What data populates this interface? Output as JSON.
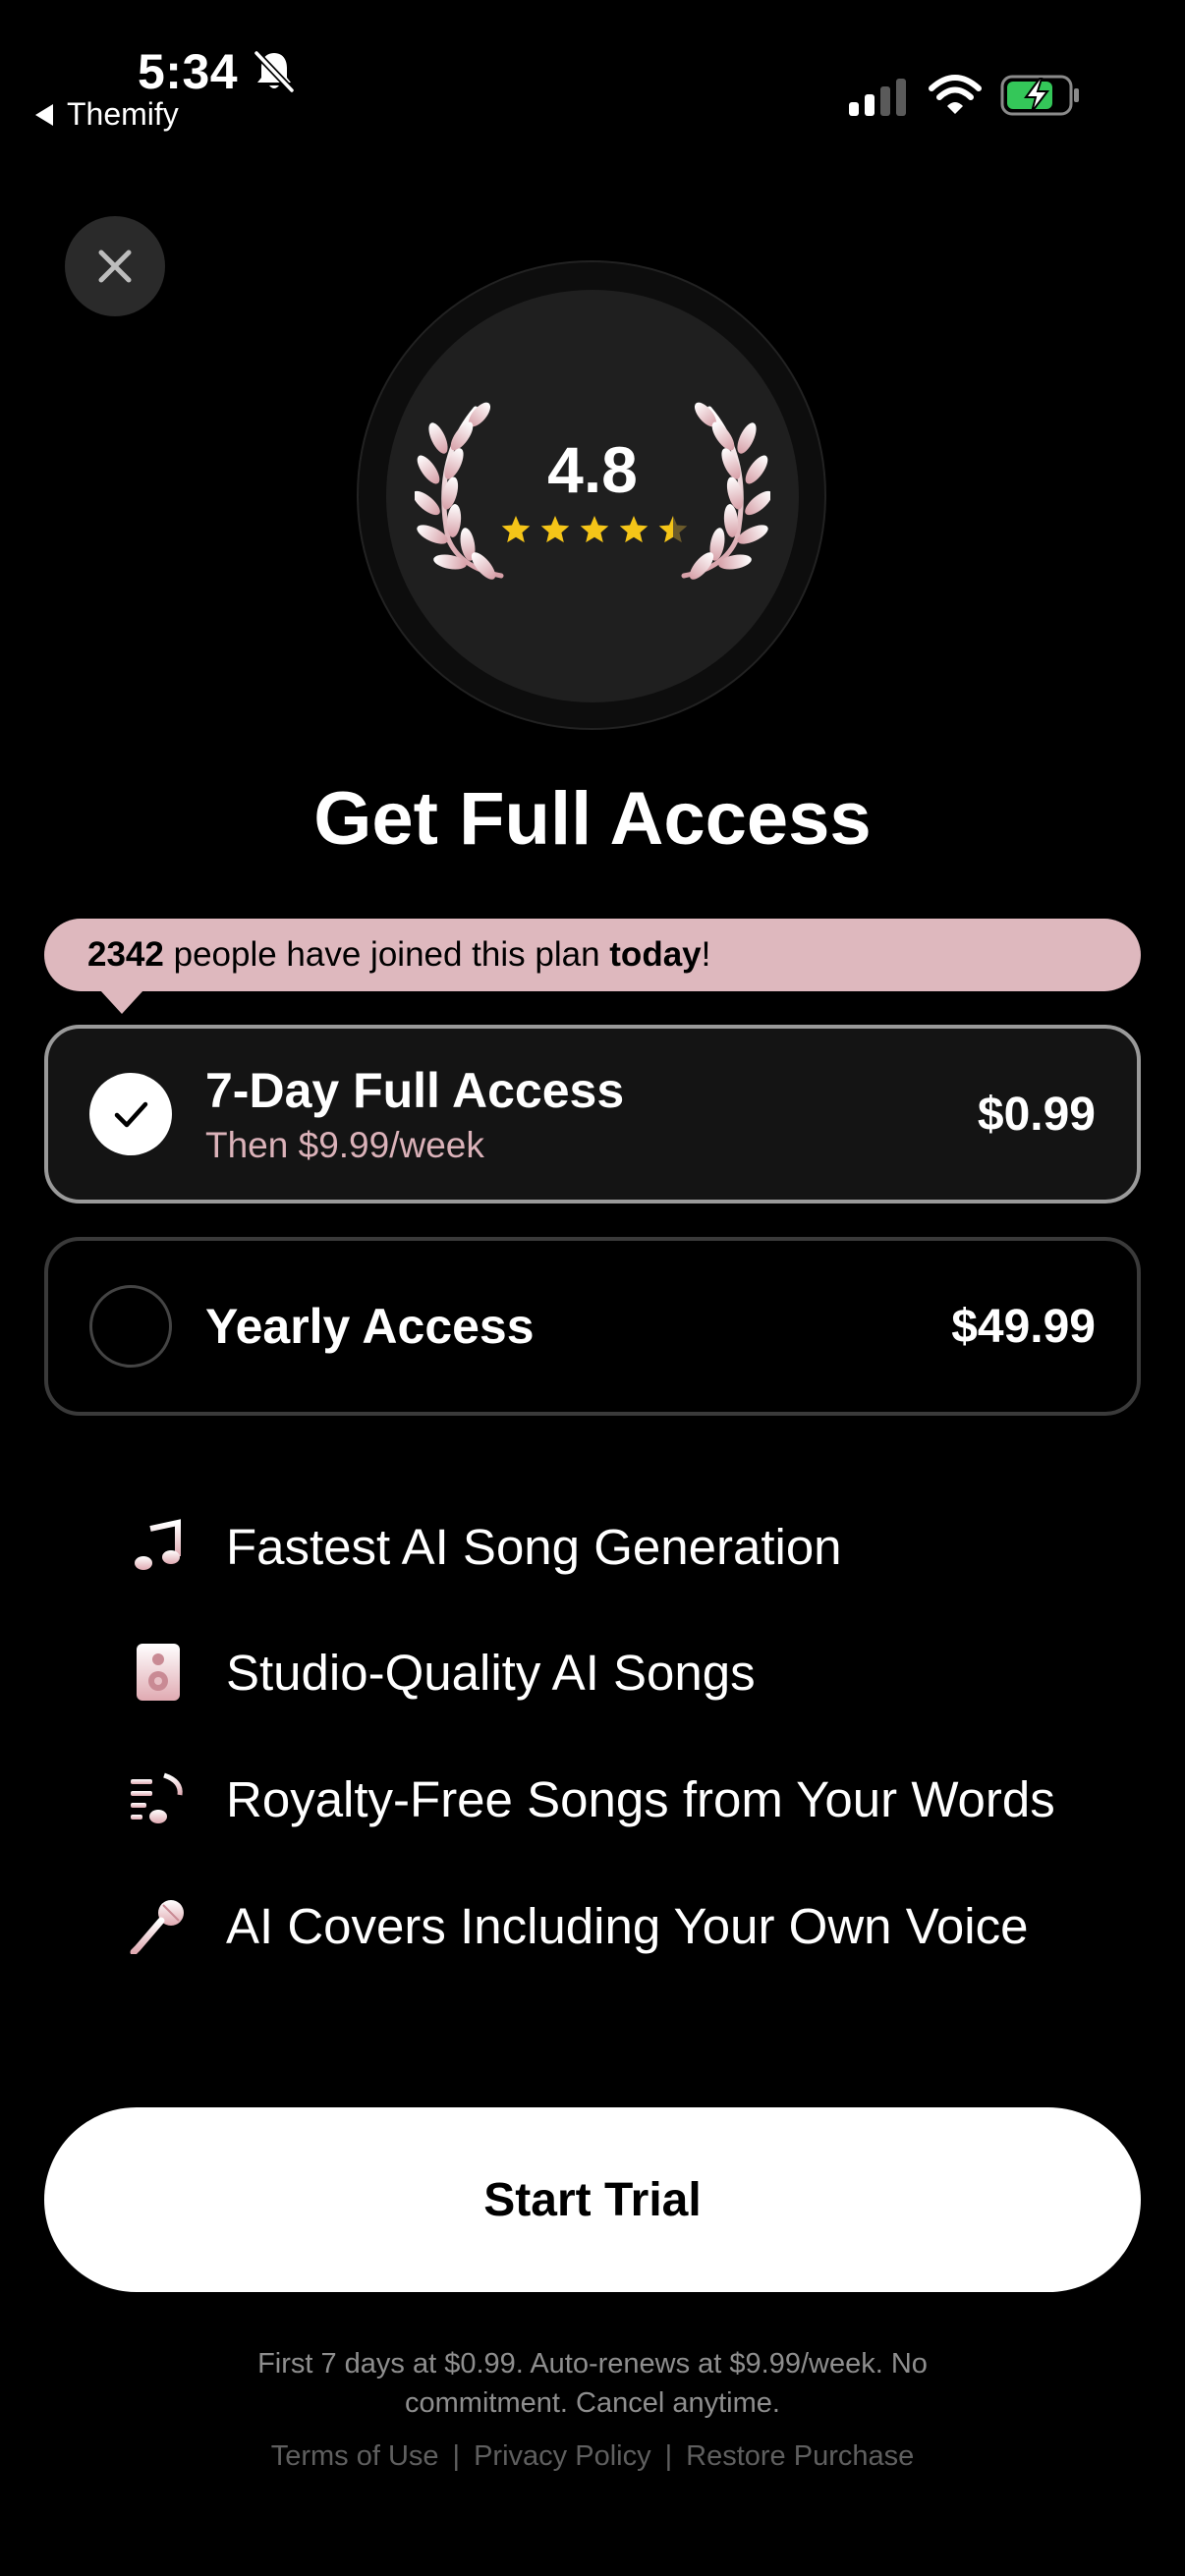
{
  "status_bar": {
    "time": "5:34",
    "back_app": "Themify",
    "icons": [
      "bell-slash-icon",
      "signal-icon",
      "wifi-icon",
      "battery-charging-icon"
    ]
  },
  "close": {
    "icon": "close-icon"
  },
  "rating": {
    "value": "4.8",
    "stars": 4.5,
    "star_color": "#f5c518"
  },
  "title": "Get Full Access",
  "banner": {
    "count": "2342",
    "middle": " people have joined this plan ",
    "emphasis": "today",
    "end": "!"
  },
  "plans": [
    {
      "name": "7-Day Full Access",
      "subtitle": "Then $9.99/week",
      "price": "$0.99",
      "selected": true
    },
    {
      "name": "Yearly Access",
      "price": "$49.99",
      "selected": false
    }
  ],
  "features": [
    {
      "icon": "music-note-icon",
      "text": "Fastest AI Song Generation"
    },
    {
      "icon": "speaker-icon",
      "text": "Studio-Quality AI Songs"
    },
    {
      "icon": "playlist-music-icon",
      "text": "Royalty-Free Songs from Your Words"
    },
    {
      "icon": "microphone-icon",
      "text": "AI Covers Including Your Own Voice"
    }
  ],
  "cta": {
    "label": "Start Trial"
  },
  "disclaimer": "First 7 days at $0.99. Auto-renews at $9.99/week. No commitment. Cancel anytime.",
  "footer": {
    "terms": "Terms of Use",
    "privacy": "Privacy Policy",
    "restore": "Restore Purchase"
  },
  "colors": {
    "accent_pink": "#deb8be",
    "background": "#000000",
    "battery_green": "#34c759"
  }
}
